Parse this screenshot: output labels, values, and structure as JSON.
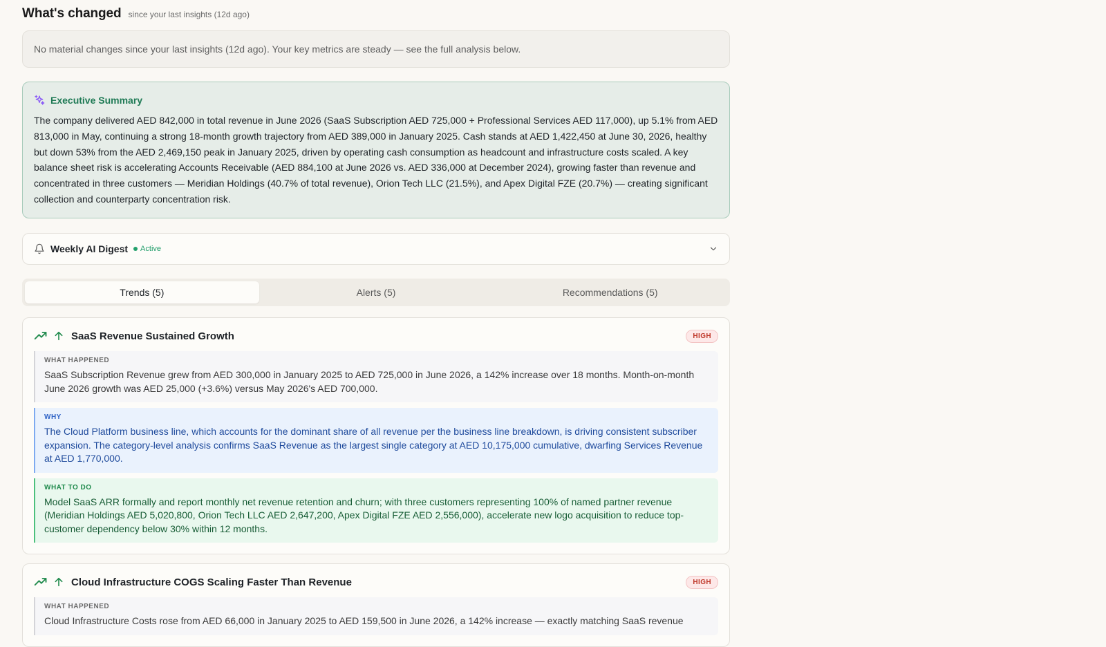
{
  "whats_changed": {
    "title": "What's changed",
    "subtitle": "since your last insights (12d ago)",
    "message": "No material changes since your last insights (12d ago). Your key metrics are steady — see the full analysis below."
  },
  "executive_summary": {
    "title": "Executive Summary",
    "icon": "sparkles-icon",
    "body": "The company delivered AED 842,000 in total revenue in June 2026 (SaaS Subscription AED 725,000 + Professional Services AED 117,000), up 5.1% from AED 813,000 in May, continuing a strong 18-month growth trajectory from AED 389,000 in January 2025. Cash stands at AED 1,422,450 at June 30, 2026, healthy but down 53% from the AED 2,469,150 peak in January 2025, driven by operating cash consumption as headcount and infrastructure costs scaled. A key balance sheet risk is accelerating Accounts Receivable (AED 884,100 at June 2026 vs. AED 336,000 at December 2024), growing faster than revenue and concentrated in three customers — Meridian Holdings (40.7% of total revenue), Orion Tech LLC (21.5%), and Apex Digital FZE (20.7%) — creating significant collection and counterparty concentration risk."
  },
  "digest": {
    "title": "Weekly AI Digest",
    "status": "Active",
    "icon": "bell-icon"
  },
  "tabs": [
    {
      "label": "Trends (5)",
      "active": true
    },
    {
      "label": "Alerts (5)",
      "active": false
    },
    {
      "label": "Recommendations (5)",
      "active": false
    }
  ],
  "trends": [
    {
      "title": "SaaS Revenue Sustained Growth",
      "badge": "HIGH",
      "what_label": "WHAT HAPPENED",
      "what": "SaaS Subscription Revenue grew from AED 300,000 in January 2025 to AED 725,000 in June 2026, a 142% increase over 18 months. Month-on-month June 2026 growth was AED 25,000 (+3.6%) versus May 2026's AED 700,000.",
      "why_label": "WHY",
      "why": "The Cloud Platform business line, which accounts for the dominant share of all revenue per the business line breakdown, is driving consistent subscriber expansion. The category-level analysis confirms SaaS Revenue as the largest single category at AED 10,175,000 cumulative, dwarfing Services Revenue at AED 1,770,000.",
      "todo_label": "WHAT TO DO",
      "todo": "Model SaaS ARR formally and report monthly net revenue retention and churn; with three customers representing 100% of named partner revenue (Meridian Holdings AED 5,020,800, Orion Tech LLC AED 2,647,200, Apex Digital FZE AED 2,556,000), accelerate new logo acquisition to reduce top-customer dependency below 30% within 12 months."
    },
    {
      "title": "Cloud Infrastructure COGS Scaling Faster Than Revenue",
      "badge": "HIGH",
      "what_label": "WHAT HAPPENED",
      "what": "Cloud Infrastructure Costs rose from AED 66,000 in January 2025 to AED 159,500 in June 2026, a 142% increase — exactly matching SaaS revenue"
    }
  ],
  "colors": {
    "accent_green": "#1f7a55",
    "badge_red": "#c0392b",
    "why_blue": "#1e4a9c",
    "todo_green": "#175c35"
  }
}
